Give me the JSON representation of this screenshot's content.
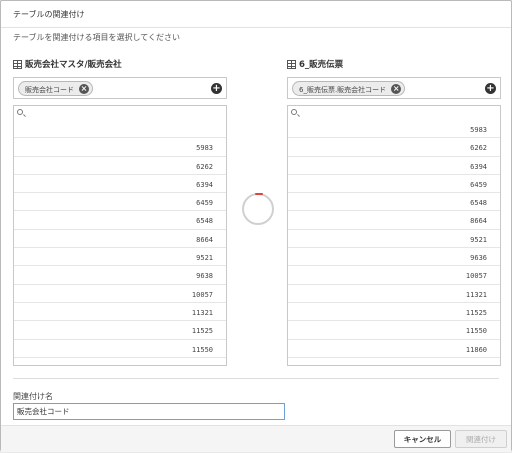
{
  "dialog": {
    "title": "テーブルの関連付け",
    "subtitle": "テーブルを関連付ける項目を選択してください"
  },
  "left": {
    "table_name": "販売会社マスタ/販売会社",
    "chip_label": "販売会社コード",
    "rows": [
      "",
      "5983",
      "6262",
      "6394",
      "6459",
      "6548",
      "8664",
      "9521",
      "9638",
      "10057",
      "11321",
      "11525",
      "11550"
    ]
  },
  "right": {
    "table_name": "6_販売伝票",
    "chip_label": "6_販売伝票.販売会社コード",
    "rows": [
      "5983",
      "6262",
      "6394",
      "6459",
      "6548",
      "8664",
      "9521",
      "9636",
      "10057",
      "11321",
      "11525",
      "11550",
      "11860"
    ]
  },
  "association": {
    "label": "関連付け名",
    "value": "販売会社コード"
  },
  "footer": {
    "cancel_label": "キャンセル",
    "associate_label": "関連付け"
  },
  "icons": {
    "table": "table-icon",
    "remove": "remove-circle-icon",
    "add": "add-circle-icon",
    "search": "search-icon",
    "loading": "loading-spinner"
  },
  "colors": {
    "focus_border": "#6aa3d6",
    "spinner_accent": "#e04040"
  }
}
